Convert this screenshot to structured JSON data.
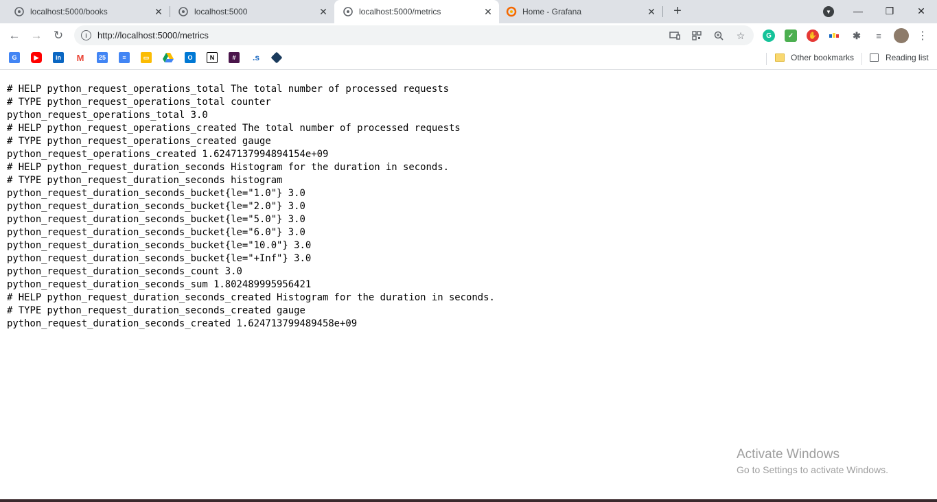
{
  "tabs": [
    {
      "title": "localhost:5000/books",
      "icon": "globe-icon",
      "active": false
    },
    {
      "title": "localhost:5000",
      "icon": "globe-icon",
      "active": false
    },
    {
      "title": "localhost:5000/metrics",
      "icon": "globe-icon",
      "active": true
    },
    {
      "title": "Home - Grafana",
      "icon": "grafana-icon",
      "active": false
    }
  ],
  "tab_close_glyph": "✕",
  "new_tab_glyph": "+",
  "window_controls": {
    "minimize": "—",
    "restore": "❐",
    "close": "✕"
  },
  "toolbar": {
    "url": "http://localhost:5000/metrics",
    "back_glyph": "←",
    "forward_glyph": "→",
    "reload_glyph": "↻"
  },
  "bookmarks": {
    "other_bookmarks": "Other bookmarks",
    "reading_list": "Reading list"
  },
  "metrics_lines": [
    "# HELP python_request_operations_total The total number of processed requests",
    "# TYPE python_request_operations_total counter",
    "python_request_operations_total 3.0",
    "# HELP python_request_operations_created The total number of processed requests",
    "# TYPE python_request_operations_created gauge",
    "python_request_operations_created 1.6247137994894154e+09",
    "# HELP python_request_duration_seconds Histogram for the duration in seconds.",
    "# TYPE python_request_duration_seconds histogram",
    "python_request_duration_seconds_bucket{le=\"1.0\"} 3.0",
    "python_request_duration_seconds_bucket{le=\"2.0\"} 3.0",
    "python_request_duration_seconds_bucket{le=\"5.0\"} 3.0",
    "python_request_duration_seconds_bucket{le=\"6.0\"} 3.0",
    "python_request_duration_seconds_bucket{le=\"10.0\"} 3.0",
    "python_request_duration_seconds_bucket{le=\"+Inf\"} 3.0",
    "python_request_duration_seconds_count 3.0",
    "python_request_duration_seconds_sum 1.802489995956421",
    "# HELP python_request_duration_seconds_created Histogram for the duration in seconds.",
    "# TYPE python_request_duration_seconds_created gauge",
    "python_request_duration_seconds_created 1.624713799489458e+09"
  ],
  "watermark": {
    "title": "Activate Windows",
    "subtitle": "Go to Settings to activate Windows."
  }
}
